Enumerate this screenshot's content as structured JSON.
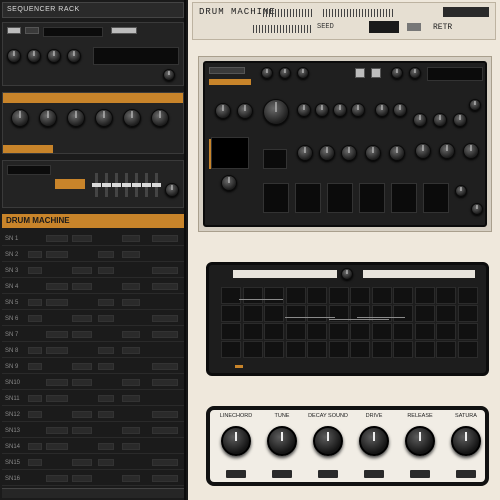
{
  "left_panel": {
    "title": "SEQUENCER RACK",
    "orange_label": "DRUM MACHINE",
    "track_labels": [
      "SN 1",
      "SN 2",
      "SN 3",
      "SN 4",
      "SN 5",
      "SN 6",
      "SN 7",
      "SN 8",
      "SN 9",
      "SN10",
      "SN11",
      "SN12",
      "SN13",
      "SN14",
      "SN15",
      "SN16"
    ]
  },
  "right_panel": {
    "title": "DRUM MACHINE",
    "mode_label": "SEED",
    "retro_label": "RETR"
  },
  "mixer": {
    "channels": [
      "LINECHORD",
      "TUNE",
      "DECAY SOUND",
      "DRIVE",
      "RELEASE",
      "SATURA"
    ]
  },
  "colors": {
    "accent": "#c8842a",
    "panel_dark": "#1f1f1f",
    "panel_light": "#efe8dc"
  }
}
